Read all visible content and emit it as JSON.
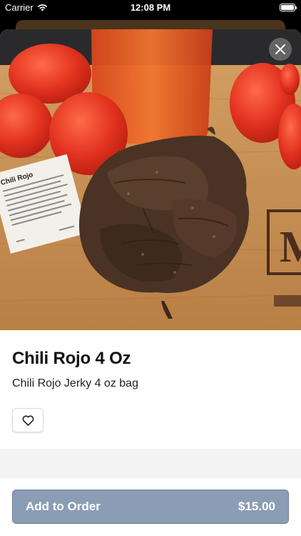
{
  "status_bar": {
    "carrier": "Carrier",
    "time": "12:08 PM"
  },
  "product": {
    "title": "Chili Rojo 4 Oz",
    "description": "Chili Rojo Jerky 4 oz bag",
    "image_label": {
      "card_title": "Chili Rojo",
      "watermark": "M"
    }
  },
  "actions": {
    "close_icon": "close-icon",
    "favorite_icon": "heart-icon",
    "add_to_order_label": "Add to Order",
    "price": "$15.00"
  },
  "colors": {
    "button_bg": "#8b9db5",
    "board": "#c89358",
    "tomato": "#e0301e"
  }
}
